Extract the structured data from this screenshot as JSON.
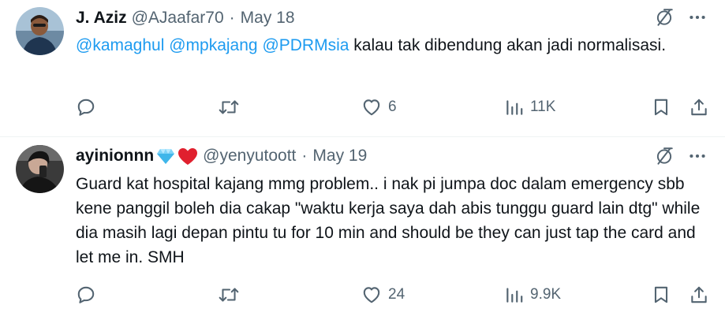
{
  "tweets": [
    {
      "display_name": "J. Aziz",
      "handle": "@AJaafar70",
      "separator": "·",
      "date": "May 18",
      "mentions": [
        "@kamaghul",
        "@mpkajang",
        "@PDRMsia"
      ],
      "text": "kalau tak dibendung akan jadi normalisasi.",
      "actions": {
        "replies": "",
        "retweets": "",
        "likes": "6",
        "views": "11K"
      },
      "icons": {
        "top": [
          "mute-icon",
          "more-icon"
        ],
        "actions": [
          "reply-icon",
          "retweet-icon",
          "like-icon",
          "views-icon",
          "bookmark-icon",
          "share-icon"
        ]
      }
    },
    {
      "display_name": "ayinionnn",
      "name_emojis": [
        "gem-emoji",
        "red-heart-emoji"
      ],
      "handle": "@yenyutoott",
      "separator": "·",
      "date": "May 19",
      "text": "Guard kat hospital kajang mmg problem.. i nak pi jumpa doc dalam emergency sbb kene panggil boleh dia cakap \"waktu kerja saya dah abis tunggu guard lain dtg\" while dia masih lagi depan pintu tu for 10 min and should be they can just tap the card and let me in. SMH",
      "actions": {
        "replies": "",
        "retweets": "",
        "likes": "24",
        "views": "9.9K"
      },
      "icons": {
        "top": [
          "mute-icon",
          "more-icon"
        ],
        "actions": [
          "reply-icon",
          "retweet-icon",
          "like-icon",
          "views-icon",
          "bookmark-icon",
          "share-icon"
        ]
      }
    }
  ],
  "colors": {
    "text": "#0f1419",
    "secondary": "#536471",
    "link": "#1d9bf0",
    "divider": "#eff3f4"
  }
}
